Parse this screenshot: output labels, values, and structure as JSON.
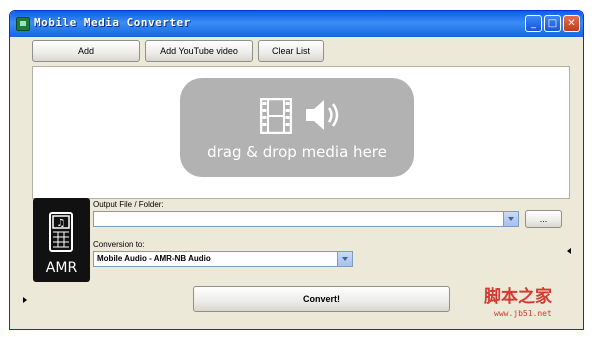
{
  "window": {
    "title": "Mobile Media Converter",
    "controls": {
      "minimize": "_",
      "maximize": "□",
      "close": "✕"
    }
  },
  "toolbar": {
    "add_label": "Add",
    "add_youtube_label": "Add YouTube video",
    "clear_list_label": "Clear List"
  },
  "dropzone": {
    "text": "drag & drop media here",
    "icons": [
      "film-icon",
      "speaker-icon"
    ]
  },
  "format_icon": {
    "label": "AMR",
    "icon": "phone-grid-icon"
  },
  "output": {
    "label": "Output File / Folder:",
    "value": "",
    "browse_label": "..."
  },
  "conversion": {
    "label": "Conversion to:",
    "selected": "Mobile Audio - AMR-NB Audio"
  },
  "convert_label": "Convert!",
  "watermark": {
    "text": "脚本之家",
    "url": "www.jb51.net"
  },
  "colors": {
    "titlebar": "#0a5fe8",
    "window_bg": "#ece9d8",
    "drop_panel": "#b2b2b2",
    "watermark": "#d43a2f"
  }
}
